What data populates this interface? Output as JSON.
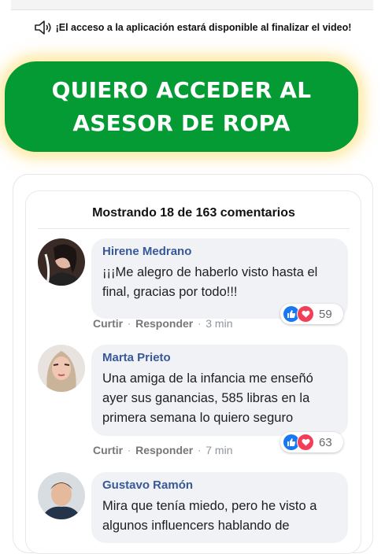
{
  "notice": {
    "text": "¡El acceso a la aplicación estará disponible al finalizar el video!",
    "icon": "speaker-icon"
  },
  "cta": {
    "label": "QUIERO ACCEDER AL ASESOR DE ROPA",
    "color": "#049a34"
  },
  "comments_header": "Mostrando 18 de 163 comentarios",
  "comments": [
    {
      "author": "Hirene Medrano",
      "text": "¡¡¡Me alegro de haberlo visto hasta el final, gracias por todo!!!",
      "like_label": "Curtir",
      "reply_label": "Responder",
      "time": "3 min",
      "reactions": "59"
    },
    {
      "author": "Marta Prieto",
      "text": "Una amiga de la infancia me enseñó ayer sus ganancias, 585 libras en la primera semana lo quiero seguro",
      "like_label": "Curtir",
      "reply_label": "Responder",
      "time": "7 min",
      "reactions": "63"
    },
    {
      "author": "Gustavo Ramón",
      "text": "Mira que tenía miedo, pero he visto a algunos influencers hablando de",
      "like_label": "Curtir",
      "reply_label": "Responder",
      "time": "",
      "reactions": ""
    }
  ],
  "colors": {
    "author": "#385898",
    "bubble": "#f0f2f5",
    "like": "#1877f2",
    "love": "#f33e58"
  }
}
